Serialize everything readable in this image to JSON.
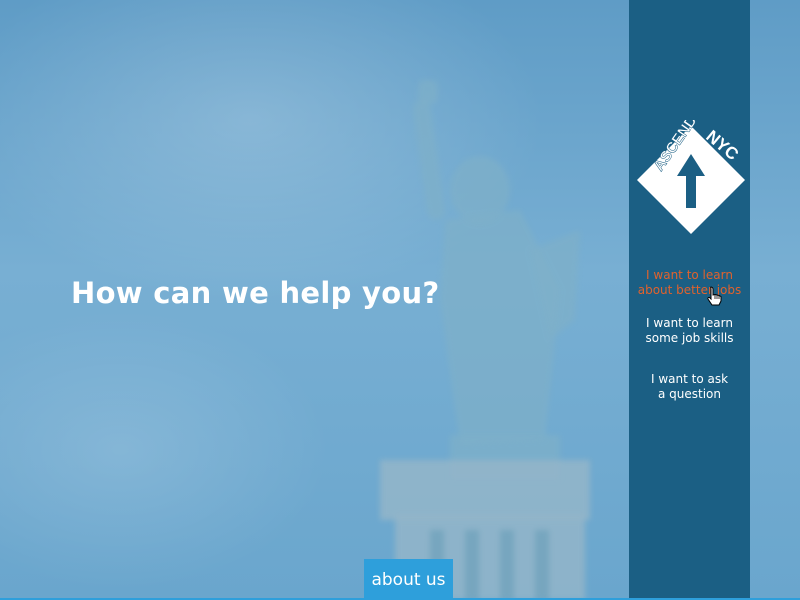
{
  "headline": "How can we help you?",
  "logo": {
    "word_left": "ASCEND",
    "word_right": "NYC"
  },
  "menu": {
    "items": [
      {
        "line1": "I want to learn",
        "line2": "about better jobs",
        "active": true
      },
      {
        "line1": "I want to learn",
        "line2": "some job skills",
        "active": false
      },
      {
        "line1": "I want to ask",
        "line2": "a question",
        "active": false
      }
    ]
  },
  "footer": {
    "about_label": "about us"
  },
  "colors": {
    "sidebar": "#1b5f84",
    "accent": "#2e9fdb",
    "active_menu": "#e0622d",
    "text": "#ffffff"
  }
}
